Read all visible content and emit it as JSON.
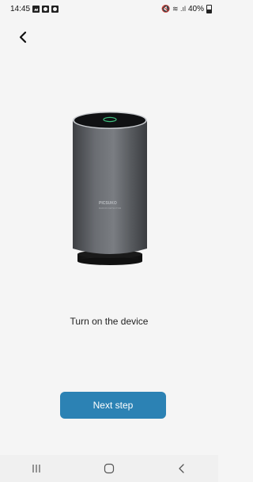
{
  "status_bar": {
    "time": "14:45",
    "signal_text": "🔇 ≋ .ıl",
    "battery": "40%"
  },
  "icons": {
    "back": "chevron-left-icon",
    "nav_recents": "recents-icon",
    "nav_home": "home-icon",
    "nav_back": "back-icon"
  },
  "main": {
    "instruction": "Turn on the device",
    "next_button_label": "Next step"
  },
  "device_label": {
    "brand": "PICSUKO",
    "subtitle": "RADON DETECTOR"
  },
  "colors": {
    "accent": "#2c82b4",
    "background": "#f5f5f5",
    "device_body": "#5a5d62"
  }
}
